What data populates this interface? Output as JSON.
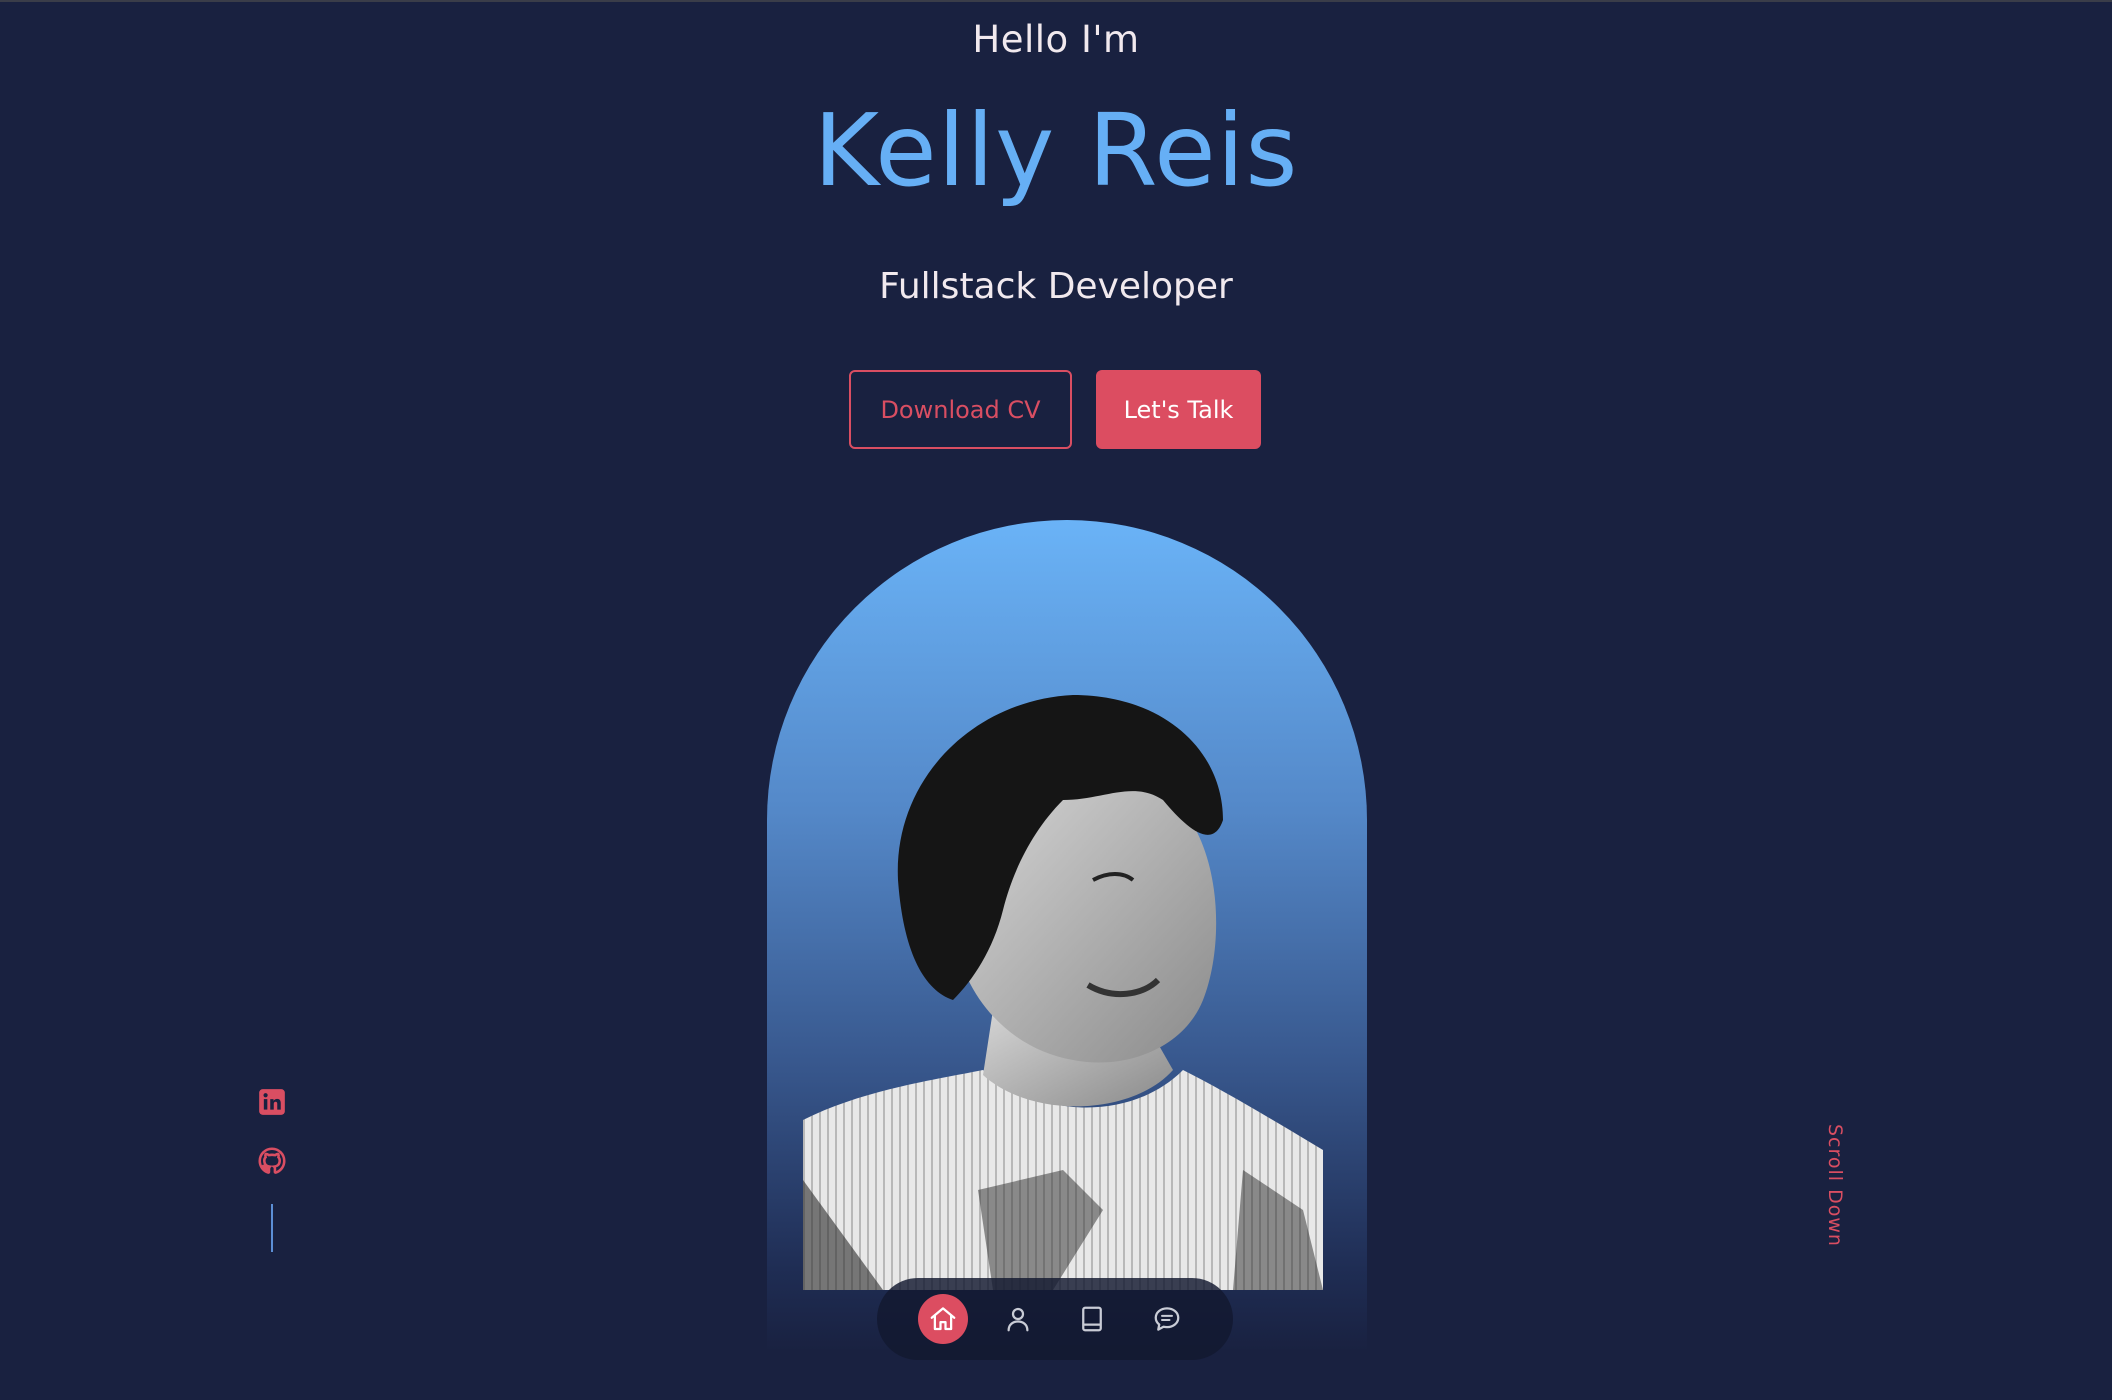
{
  "hero": {
    "greeting": "Hello I'm",
    "name": "Kelly Reis",
    "role": "Fullstack Developer"
  },
  "buttons": {
    "download_cv": "Download CV",
    "lets_talk": "Let's Talk"
  },
  "social": {
    "links": [
      {
        "icon": "linkedin-icon"
      },
      {
        "icon": "github-icon"
      }
    ]
  },
  "scroll": {
    "label": "Scroll Down"
  },
  "nav": {
    "items": [
      {
        "icon": "home-icon",
        "active": true
      },
      {
        "icon": "user-icon",
        "active": false
      },
      {
        "icon": "book-icon",
        "active": false
      },
      {
        "icon": "message-icon",
        "active": false
      }
    ]
  },
  "colors": {
    "background": "#192140",
    "accent": "#dc4d61",
    "name_blue": "#66aff5",
    "text": "#f1e9ee"
  }
}
